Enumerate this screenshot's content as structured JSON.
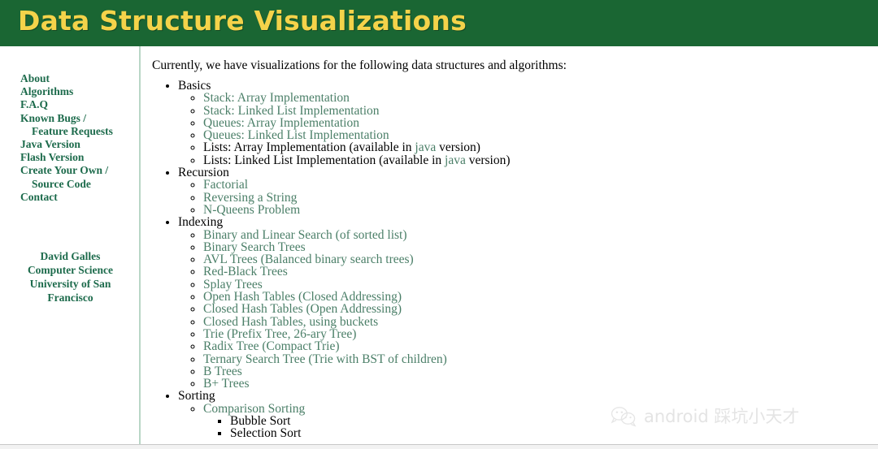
{
  "header": {
    "title": "Data Structure Visualizations",
    "background_color": "#1a6633",
    "title_color": "#f4d34a"
  },
  "sidebar": {
    "link_color": "#1d6b4c",
    "items": [
      {
        "label": "About",
        "indented": false
      },
      {
        "label": "Algorithms",
        "indented": false
      },
      {
        "label": "F.A.Q",
        "indented": false
      },
      {
        "label": "Known Bugs /",
        "indented": false
      },
      {
        "label": "Feature Requests",
        "indented": true
      },
      {
        "label": "Java Version",
        "indented": false
      },
      {
        "label": "Flash Version",
        "indented": false
      },
      {
        "label": "Create Your Own /",
        "indented": false
      },
      {
        "label": "Source Code",
        "indented": true
      },
      {
        "label": "Contact",
        "indented": false
      }
    ],
    "author": [
      "David Galles",
      "Computer Science",
      "University of San",
      "Francisco"
    ]
  },
  "main": {
    "intro": "Currently, we have visualizations for the following data structures and algorithms:",
    "link_color": "#4b7f68",
    "sections": [
      {
        "heading": "Basics",
        "items": [
          {
            "type": "link",
            "label": "Stack: Array Implementation"
          },
          {
            "type": "link",
            "label": "Stack: Linked List Implementation"
          },
          {
            "type": "link",
            "label": "Queues: Array Implementation"
          },
          {
            "type": "link",
            "label": "Queues: Linked List Implementation"
          },
          {
            "type": "mixed",
            "prefix": "Lists: Array Implementation (available in ",
            "link": "java",
            "suffix": " version)"
          },
          {
            "type": "mixed",
            "prefix": "Lists: Linked List Implementation (available in ",
            "link": "java",
            "suffix": " version)"
          }
        ]
      },
      {
        "heading": "Recursion",
        "items": [
          {
            "type": "link",
            "label": "Factorial"
          },
          {
            "type": "link",
            "label": "Reversing a String"
          },
          {
            "type": "link",
            "label": "N-Queens Problem"
          }
        ]
      },
      {
        "heading": "Indexing",
        "items": [
          {
            "type": "link",
            "label": "Binary and Linear Search (of sorted list)"
          },
          {
            "type": "link",
            "label": "Binary Search Trees"
          },
          {
            "type": "link",
            "label": "AVL Trees (Balanced binary search trees)"
          },
          {
            "type": "link",
            "label": "Red-Black Trees"
          },
          {
            "type": "link",
            "label": "Splay Trees"
          },
          {
            "type": "link",
            "label": "Open Hash Tables (Closed Addressing)"
          },
          {
            "type": "link",
            "label": "Closed Hash Tables (Open Addressing)"
          },
          {
            "type": "link",
            "label": "Closed Hash Tables, using buckets"
          },
          {
            "type": "link",
            "label": "Trie (Prefix Tree, 26-ary Tree)"
          },
          {
            "type": "link",
            "label": "Radix Tree (Compact Trie)"
          },
          {
            "type": "link",
            "label": "Ternary Search Tree (Trie with BST of children)"
          },
          {
            "type": "link",
            "label": "B Trees"
          },
          {
            "type": "link",
            "label": "B+ Trees"
          }
        ]
      },
      {
        "heading": "Sorting",
        "items": [
          {
            "type": "link",
            "label": "Comparison Sorting",
            "children": [
              {
                "type": "plain",
                "label": "Bubble Sort"
              },
              {
                "type": "plain",
                "label": "Selection Sort"
              }
            ]
          }
        ]
      }
    ]
  },
  "watermark": {
    "text": "android 踩坑小天才",
    "icon": "wechat-icon",
    "color": "#e2e2e2"
  }
}
